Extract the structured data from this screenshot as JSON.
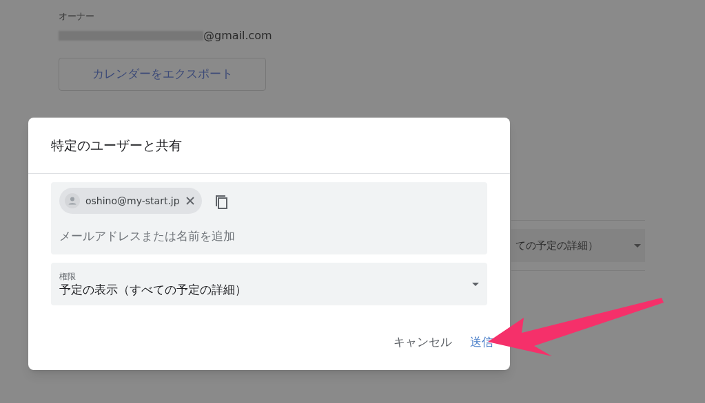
{
  "background": {
    "owner_label": "オーナー",
    "owner_email": "@gmail.com",
    "export_button": "カレンダーをエクスポート",
    "permission_select_partial": "ての予定の詳細）"
  },
  "dialog": {
    "title": "特定のユーザーと共有",
    "chips": [
      {
        "email": "oshino@my-start.jp"
      }
    ],
    "add_field": {
      "placeholder": "メールアドレスまたは名前を追加"
    },
    "permission": {
      "label": "権限",
      "value": "予定の表示（すべての予定の詳細）"
    },
    "buttons": [
      {
        "label": "キャンセル",
        "kind": "secondary"
      },
      {
        "label": "送信",
        "kind": "primary"
      }
    ]
  }
}
